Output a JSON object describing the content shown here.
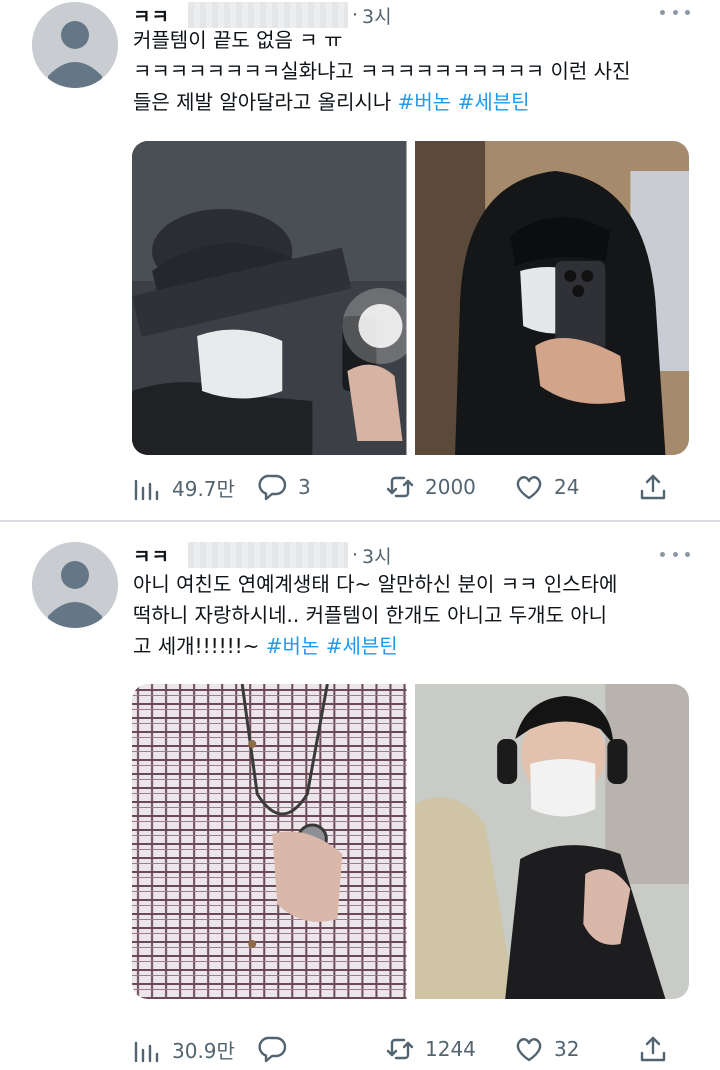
{
  "tweets": [
    {
      "name": "ㅋㅋ",
      "separator_dot": "·",
      "time": "3시",
      "text_plain": "커플템이 끝도 없음 ㅋ ㅠ\nㅋㅋㅋㅋㅋㅋㅋㅋ실화냐고 ㅋㅋㅋㅋㅋㅋㅋㅋㅋㅋ 이런 사진\n들은 제발 알아달라고 올리시나 ",
      "hashtags": [
        "#버논",
        "#세븐틴"
      ],
      "stats": {
        "views": "49.7만",
        "replies": "3",
        "retweets": "2000",
        "likes": "24"
      }
    },
    {
      "name": "ㅋㅋ",
      "separator_dot": "·",
      "time": "3시",
      "text_plain": "아니 여친도 연예계생태 다~ 알만하신 분이 ㅋㅋ 인스타에\n떡하니 자랑하시네.. 커플템이 한개도 아니고 두개도 아니\n고 세개!!!!!!~ ",
      "hashtags": [
        "#버논",
        "#세븐틴"
      ],
      "stats": {
        "views": "30.9만",
        "replies": "",
        "retweets": "1244",
        "likes": "32"
      }
    }
  ],
  "colors": {
    "hashtag": "#1d9bf0",
    "secondary_text": "#536471",
    "separator": "#d9dde1"
  },
  "icons": [
    "more-icon",
    "views-icon",
    "reply-icon",
    "retweet-icon",
    "like-icon",
    "share-icon"
  ]
}
